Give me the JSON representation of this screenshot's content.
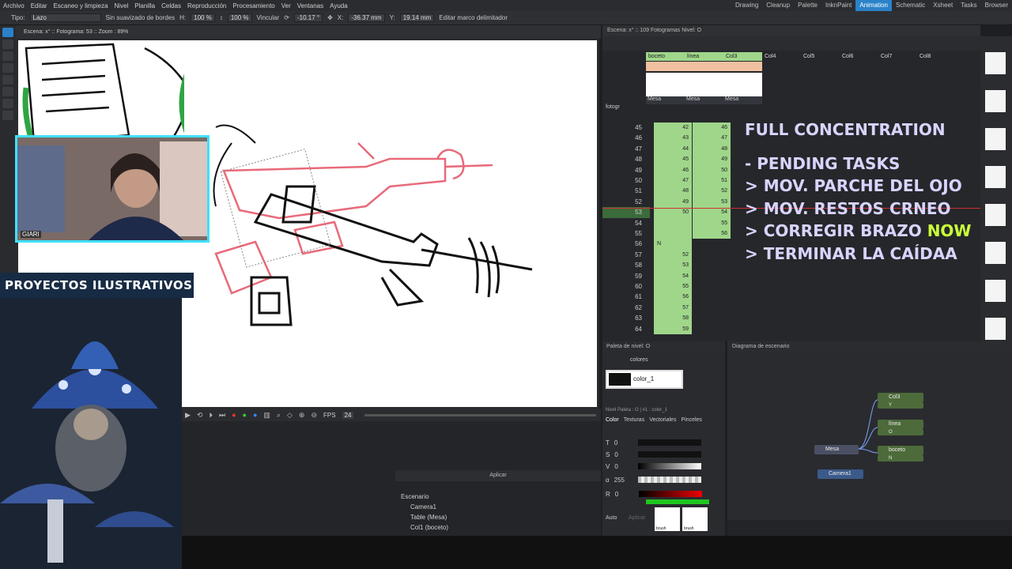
{
  "menu": [
    "Archivo",
    "Editar",
    "Escaneo y limpieza",
    "Nivel",
    "Planilla",
    "Celdas",
    "Reproducción",
    "Procesamiento",
    "Ver",
    "Ventanas",
    "Ayuda"
  ],
  "rooms": {
    "items": [
      "Drawing",
      "Cleanup",
      "Palette",
      "InknPaint",
      "Animation",
      "Schematic",
      "Xsheet",
      "Tasks",
      "Browser"
    ],
    "active": "Animation"
  },
  "tool_options": {
    "type_label": "Tipo:",
    "type_value": "Lazo",
    "no_smoothing": "Sin suavizado de bordes",
    "h_label": "H:",
    "h_value": "100 %",
    "v_value": "100 %",
    "link_label": "Vincular",
    "rotation": "-10.17 °",
    "x_label": "X:",
    "x_value": "-36.37 mm",
    "y_label": "Y:",
    "y_value": "19.14 mm",
    "edit_bbox": "Editar marco delimitador"
  },
  "viewer": {
    "status": "Escena: x° :: Fotograma: 53 :: Zoom : 89%"
  },
  "playback": {
    "fps_label": "FPS",
    "fps_value": "24"
  },
  "lower_panel": {
    "apply": "Aplicar"
  },
  "scene_tree": [
    "Escenario",
    "Camera1",
    "Table (Mesa)",
    "Col1 (boceto)"
  ],
  "webcam": {
    "label": "GIARI"
  },
  "banner": "PROYECTOS ILUSTRATIVOS",
  "xsheet": {
    "header": "Escena: x° :: 109 Fotogramas Nivel: O",
    "frame_label": "fotogr",
    "columns": [
      {
        "name": "boceto",
        "sub": "Mesa",
        "color": "#9fd68a"
      },
      {
        "name": "línea",
        "sub": "Mesa",
        "color": "#9fd68a"
      },
      {
        "name": "Col3",
        "sub": "Mesa",
        "color": "#9fd68a"
      },
      {
        "name": "Col4"
      },
      {
        "name": "Col5"
      },
      {
        "name": "Col6"
      },
      {
        "name": "Col7"
      },
      {
        "name": "Col8"
      }
    ],
    "frames": [
      "45",
      "46",
      "47",
      "48",
      "49",
      "50",
      "51",
      "52",
      "53",
      "54",
      "55",
      "56",
      "57",
      "58",
      "59",
      "60",
      "61",
      "62",
      "63",
      "64"
    ],
    "col1_cells": [
      "42",
      "43",
      "44",
      "45",
      "46",
      "47",
      "48",
      "49",
      "50",
      "",
      "",
      "",
      "52",
      "53",
      "54",
      "55",
      "56",
      "57",
      "58",
      "59"
    ],
    "col2_cells": [
      "46",
      "47",
      "48",
      "49",
      "50",
      "51",
      "52",
      "53",
      "54",
      "55",
      "56",
      "",
      "",
      "",
      "",
      "",
      "",
      "",
      "",
      ""
    ],
    "n_marker": "N",
    "n_marker2": "51"
  },
  "tasks": {
    "title": "FULL CONCENTRATION",
    "heading": "- PENDING TASKS",
    "items": [
      "> MOV. PARCHE DEL OJO",
      "> MOV. RESTOS CRNEO",
      "> CORREGIR BRAZO",
      "> TERMINAR LA CAÍDAA"
    ],
    "now": "NOW"
  },
  "palette": {
    "header": "Paleta de nivel: O",
    "tab": "colores",
    "style_name": "color_1",
    "level_info": "Nivel Paleta : O | #1 : color_1",
    "tabs": [
      "Color",
      "Texturas",
      "Vectoriales",
      "Pinceles"
    ],
    "channels": [
      {
        "k": "T",
        "v": "0"
      },
      {
        "k": "S",
        "v": "0"
      },
      {
        "k": "V",
        "v": "0"
      },
      {
        "k": "α",
        "v": "255"
      },
      {
        "k": "R",
        "v": "0"
      }
    ],
    "auto": "Auto",
    "apply": "Aplicar",
    "brush_label": "brush"
  },
  "schematic": {
    "header": "Diagrama de escenario",
    "nodes": {
      "col3": "Col3",
      "col3_sub": "Y",
      "linea": "línea",
      "linea_sub": "O",
      "boceto": "boceto",
      "boceto_sub": "N",
      "mesa": "Mesa",
      "camera": "Camera1"
    }
  },
  "colors": {
    "accent": "#2b82c9",
    "xsheet_cell": "#9fd68a",
    "current_frame": "#d03030",
    "now_text": "#caff3a",
    "task_text": "#d8d4ff",
    "cam_border": "#3fe0ff"
  }
}
